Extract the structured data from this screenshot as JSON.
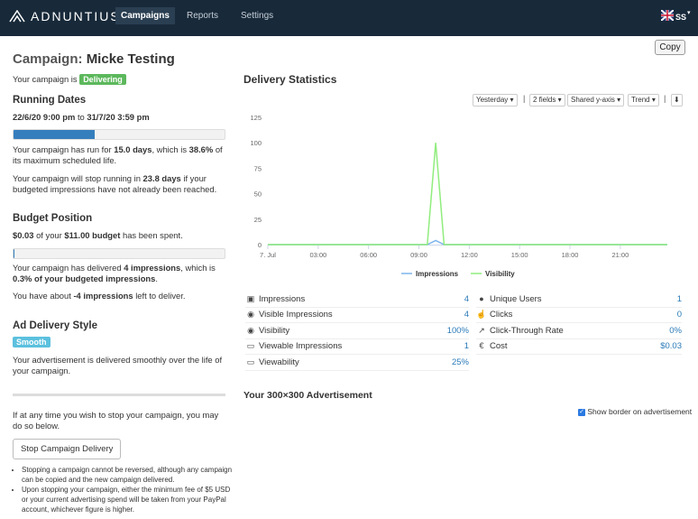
{
  "nav": {
    "logo": "ADNUNTIUS",
    "items": [
      "Campaigns",
      "Reports",
      "Settings"
    ],
    "user": "SS"
  },
  "copy_label": "Copy",
  "campaign": {
    "title_prefix": "Campaign:",
    "title_name": "Micke Testing",
    "status_prefix": "Your campaign is",
    "status": "Delivering"
  },
  "running": {
    "heading": "Running Dates",
    "start": "22/6/20 9:00 pm",
    "to": "to",
    "end": "31/7/20 3:59 pm",
    "progress": 0.386,
    "run_text_1": "Your campaign has run for",
    "run_days": "15.0 days",
    "run_text_2": ", which is",
    "run_pct": "38.6%",
    "run_text_3": "of its maximum scheduled life.",
    "stop_text_1": "Your campaign will stop running in",
    "stop_days": "23.8 days",
    "stop_text_2": "if your budgeted impressions have not already been reached."
  },
  "budget": {
    "heading": "Budget Position",
    "spent": "$0.03",
    "of": "of your",
    "budget": "$11.00 budget",
    "spent_suffix": "has been spent.",
    "progress": 0.003,
    "deliv_1": "Your campaign has delivered",
    "deliv_imps": "4 impressions",
    "deliv_2": ", which is",
    "deliv_pct": "0.3% of your budgeted impressions",
    "deliv_3": ".",
    "left_1": "You have about",
    "left_imps": "-4 impressions",
    "left_2": "left to deliver."
  },
  "style": {
    "heading": "Ad Delivery Style",
    "badge": "Smooth",
    "text": "Your advertisement is delivered smoothly over the life of your campaign."
  },
  "stop": {
    "text": "If at any time you wish to stop your campaign, you may do so below.",
    "button": "Stop Campaign Delivery",
    "notes": [
      "Stopping a campaign cannot be reversed, although any campaign can be copied and the new campaign delivered.",
      "Upon stopping your campaign, either the minimum fee of $5 USD or your current advertising spend will be taken from your PayPal account, whichever figure is higher."
    ]
  },
  "delivery": {
    "heading": "Delivery Statistics",
    "controls": [
      "Yesterday",
      "2 fields",
      "Shared y-axis",
      "Trend"
    ],
    "stats_left": [
      {
        "icon": "image-icon",
        "label": "Impressions",
        "value": "4"
      },
      {
        "icon": "eye-icon",
        "label": "Visible Impressions",
        "value": "4"
      },
      {
        "icon": "eye-icon",
        "label": "Visibility",
        "value": "100%"
      },
      {
        "icon": "monitor-icon",
        "label": "Viewable Impressions",
        "value": "1"
      },
      {
        "icon": "monitor-icon",
        "label": "Viewability",
        "value": "25%"
      }
    ],
    "stats_right": [
      {
        "icon": "user-icon",
        "label": "Unique Users",
        "value": "1"
      },
      {
        "icon": "pointer-icon",
        "label": "Clicks",
        "value": "0"
      },
      {
        "icon": "chart-line-icon",
        "label": "Click-Through Rate",
        "value": "0%"
      },
      {
        "icon": "euro-icon",
        "label": "Cost",
        "value": "$0.03"
      }
    ]
  },
  "chart_data": {
    "type": "line",
    "x": [
      "7. Jul",
      "03:00",
      "06:00",
      "09:00",
      "12:00",
      "15:00",
      "18:00",
      "21:00"
    ],
    "ylim": [
      0,
      125
    ],
    "yticks": [
      0,
      25,
      50,
      75,
      100,
      125
    ],
    "series": [
      {
        "name": "Impressions",
        "color": "#7cb5ec",
        "points": [
          [
            0,
            0
          ],
          [
            9.5,
            0
          ],
          [
            10,
            4
          ],
          [
            10.5,
            0
          ],
          [
            23.8,
            0
          ]
        ]
      },
      {
        "name": "Visibility",
        "color": "#90ed7d",
        "points": [
          [
            0,
            0
          ],
          [
            9.5,
            0
          ],
          [
            10,
            100
          ],
          [
            10.5,
            0
          ],
          [
            23.8,
            0
          ]
        ]
      }
    ],
    "legend": "bottom"
  },
  "advert": {
    "heading": "Your 300×300 Advertisement",
    "checkbox_label": "Show border on advertisement"
  }
}
